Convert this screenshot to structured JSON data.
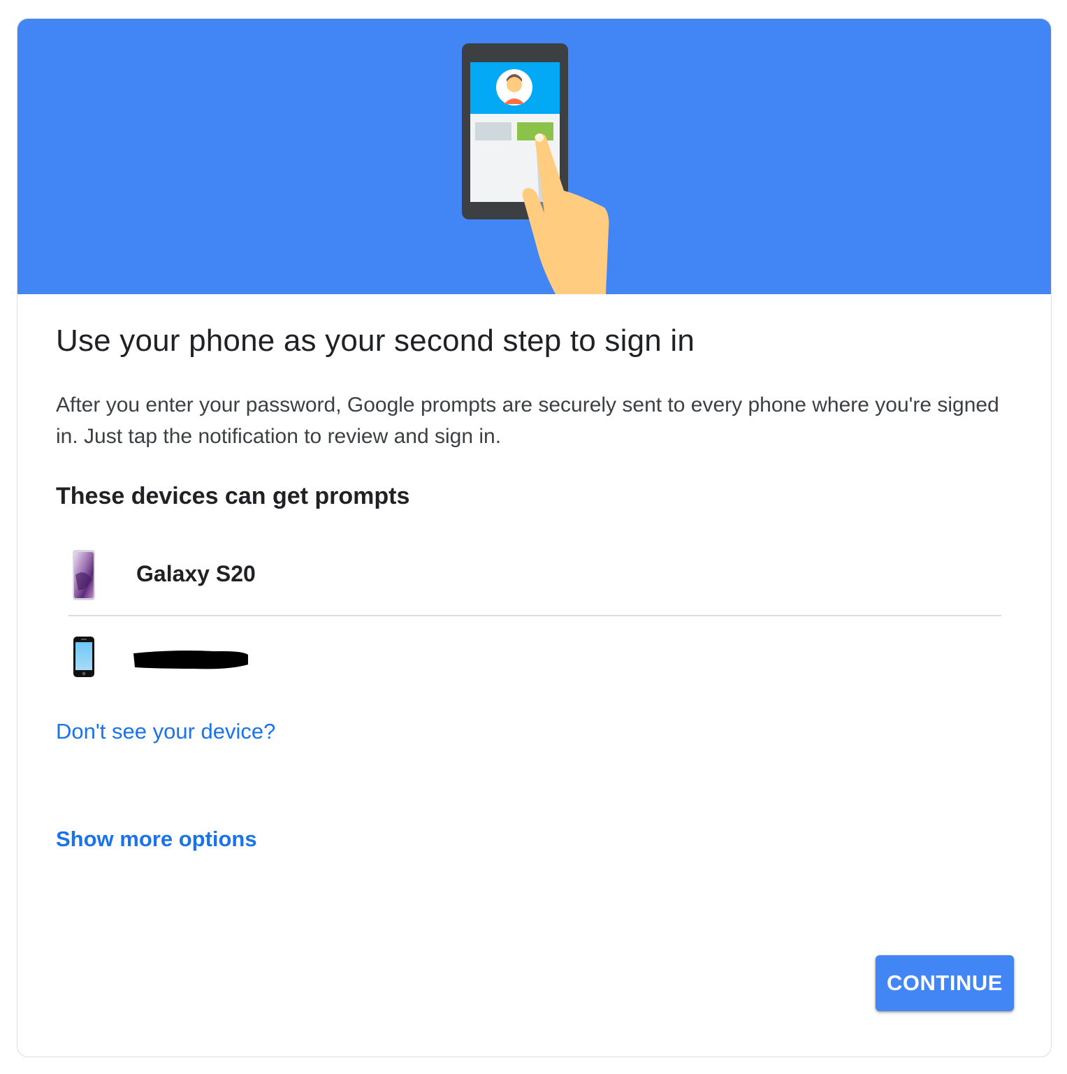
{
  "hero": {
    "illustration": "phone-tap-illustration",
    "background_color": "#4285f4"
  },
  "main": {
    "title": "Use your phone as your second step to sign in",
    "description": "After you enter your password, Google prompts are securely sent to every phone where you're signed in. Just tap the notification to review and sign in.",
    "devices_heading": "These devices can get prompts",
    "devices": [
      {
        "name": "Galaxy S20",
        "icon": "android-phone-icon"
      },
      {
        "name": "",
        "icon": "iphone-icon",
        "redacted": true
      }
    ],
    "dont_see_device_link": "Don't see your device?",
    "show_more_options_link": "Show more options"
  },
  "footer": {
    "continue_label": "CONTINUE"
  },
  "colors": {
    "accent": "#4285f4",
    "link": "#1a73e8",
    "text_primary": "#202124",
    "text_secondary": "#3c4043"
  }
}
